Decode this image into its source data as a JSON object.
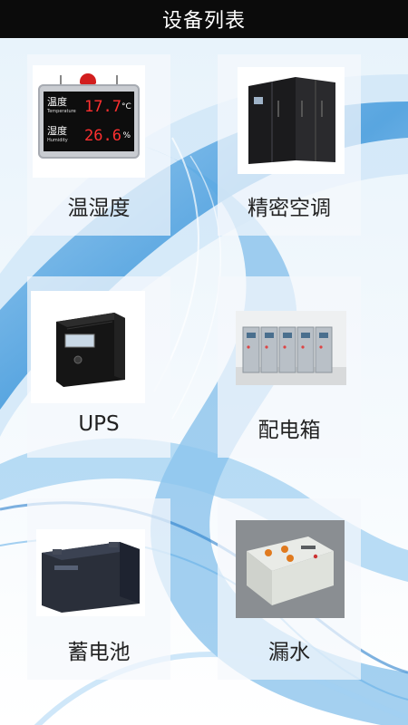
{
  "header": {
    "title": "设备列表"
  },
  "devices": [
    {
      "label": "温湿度",
      "icon": "temperature-humidity-display-icon",
      "display": {
        "temp_label": "温度",
        "temp_label_en": "Temperature",
        "temp_value": "17.7",
        "temp_unit": "°C",
        "hum_label": "湿度",
        "hum_label_en": "Humidity",
        "hum_value": "26.6",
        "hum_unit": "%"
      }
    },
    {
      "label": "精密空调",
      "icon": "precision-air-conditioner-icon"
    },
    {
      "label": "UPS",
      "icon": "ups-icon"
    },
    {
      "label": "配电箱",
      "icon": "distribution-box-icon"
    },
    {
      "label": "蓄电池",
      "icon": "battery-icon"
    },
    {
      "label": "漏水",
      "icon": "water-leak-sensor-icon"
    }
  ],
  "colors": {
    "header_bg": "#0b0b0b",
    "accent_blue": "#2f8fd8"
  }
}
